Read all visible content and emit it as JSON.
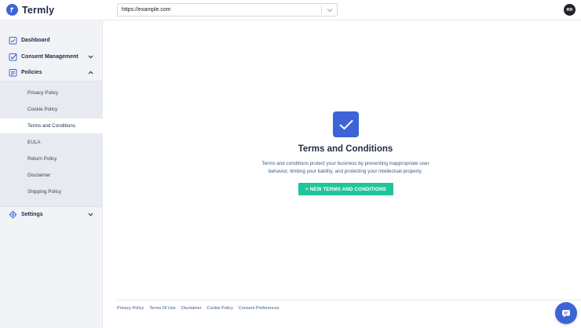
{
  "header": {
    "brand": "Termly",
    "url_value": "https://example.com",
    "avatar_initials": "RR"
  },
  "sidebar": {
    "items": [
      {
        "label": "Dashboard",
        "icon": "dashboard-icon"
      },
      {
        "label": "Consent Management",
        "icon": "consent-check-icon"
      },
      {
        "label": "Policies",
        "icon": "policies-doc-icon"
      },
      {
        "label": "Settings",
        "icon": "gear-icon"
      }
    ],
    "policies_sub": [
      {
        "label": "Privacy Policy"
      },
      {
        "label": "Cookie Policy"
      },
      {
        "label": "Terms and Conditions"
      },
      {
        "label": "EULA"
      },
      {
        "label": "Return Policy"
      },
      {
        "label": "Disclaimer"
      },
      {
        "label": "Shipping Policy"
      }
    ]
  },
  "main": {
    "title": "Terms and Conditions",
    "description": "Terms and conditions protect your business by preventing inappropriate user behavior, limiting your liability, and protecting your intellectual property.",
    "cta_label": "+ NEW TERMS AND CONDITIONS"
  },
  "footer": {
    "links": [
      "Privacy Policy",
      "Terms Of Use",
      "Disclaimer",
      "Cookie Policy",
      "Consent Preferences"
    ]
  },
  "colors": {
    "brand_blue": "#3d64d6",
    "cta_green": "#1fc59b",
    "text_dark": "#1f2a44",
    "sidebar_bg": "#f2f3f7"
  }
}
